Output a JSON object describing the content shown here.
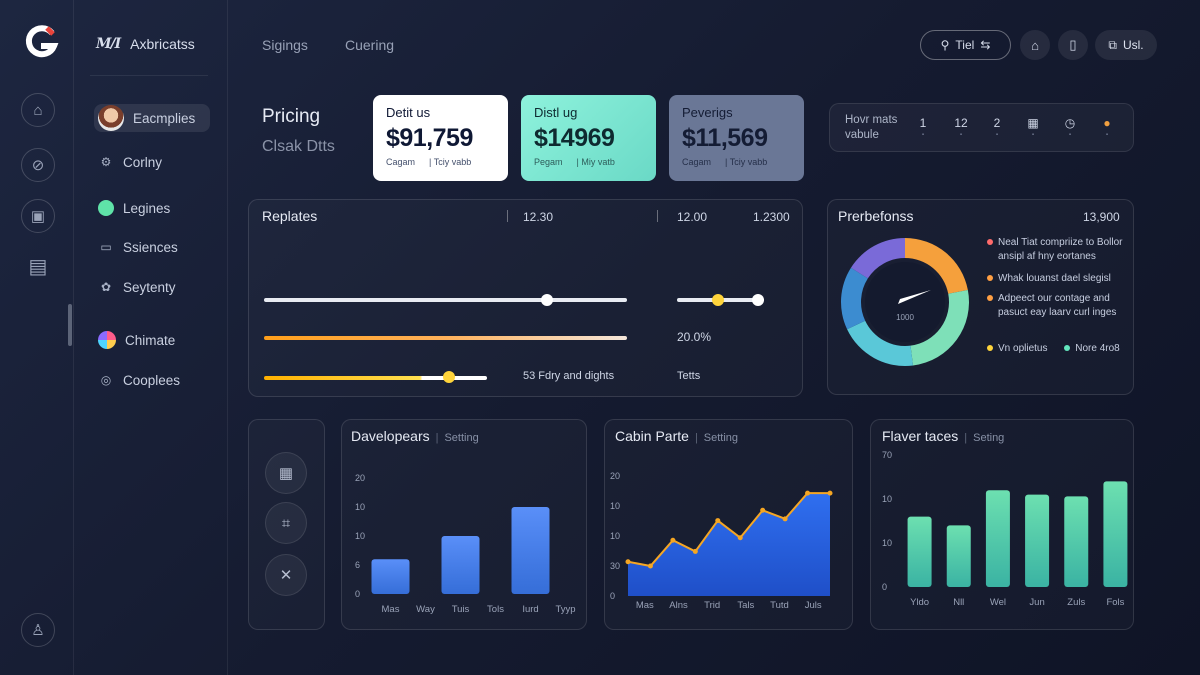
{
  "brand": {
    "mark": "M/I",
    "name": "Axbricatss"
  },
  "topnav": [
    {
      "label": "Sigings"
    },
    {
      "label": "Cuering"
    }
  ],
  "search": {
    "label": "Tiel"
  },
  "user": {
    "label": "Usl."
  },
  "sidebar": {
    "items": [
      {
        "label": "Eacmplies",
        "icon": "avatar"
      },
      {
        "label": "Corlny",
        "icon": "settings-icon"
      },
      {
        "label": "Legines",
        "icon": "green-dot-icon"
      },
      {
        "label": "Ssiences",
        "icon": "monitor-icon"
      },
      {
        "label": "Seytenty",
        "icon": "gear-icon"
      },
      {
        "label": "Chimate",
        "icon": "color-wheel-icon"
      },
      {
        "label": "Cooplees",
        "icon": "target-icon"
      }
    ]
  },
  "page": {
    "title": "Pricing",
    "subtitle": "Clsak Dtts"
  },
  "stats": [
    {
      "label": "Detit us",
      "value": "$91,759",
      "foot_left": "Cagam",
      "foot_right": "| Tciy vabb"
    },
    {
      "label": "Distl ug",
      "value": "$14969",
      "foot_left": "Pegam",
      "foot_right": "| Miy vatb"
    },
    {
      "label": "Peverigs",
      "value": "$11,569",
      "foot_left": "Cagam",
      "foot_right": "| Tciy vabb"
    }
  ],
  "iconbar": {
    "label_line1": "Hovr mats",
    "label_line2": "vabule",
    "cells": [
      "1",
      "12",
      "2",
      "",
      "",
      ""
    ]
  },
  "replates": {
    "title": "Replates",
    "col1": "12.30",
    "col2": "12.00",
    "col3": "1.2300",
    "row2_value": "20.0%",
    "row3_label": "53 Fdry and dights",
    "row3_value": "Tetts",
    "slider1_value": 0.78,
    "slider2_value": 0.47,
    "slider3_value": 0.83
  },
  "preferences": {
    "title": "Prerbefonss",
    "value": "13,900",
    "gauge_label": "1000",
    "legend": [
      {
        "text": "Neal Tiat compriize to Bollor",
        "color": "#ff6b6b"
      },
      {
        "text": "ansipl af hny eortanes",
        "color": ""
      },
      {
        "text": "Whak louanst dael slegisl",
        "color": "#ff9f43"
      },
      {
        "text": "Adpeect our contage and",
        "color": "#ff9f43"
      },
      {
        "text": "pasuct eay laarv curl inges",
        "color": ""
      }
    ],
    "legend_bottom": [
      {
        "text": "Vn oplietus",
        "color": "#ffd43b"
      },
      {
        "text": "Nore 4ro8",
        "color": "#63e6be"
      }
    ],
    "segments": [
      {
        "value": 22,
        "color": "#f5a03c"
      },
      {
        "value": 26,
        "color": "#7ee0b8"
      },
      {
        "value": 20,
        "color": "#5ac8d8"
      },
      {
        "value": 16,
        "color": "#3c8cd0"
      },
      {
        "value": 16,
        "color": "#7a6ad8"
      }
    ]
  },
  "chart_data": [
    {
      "type": "bar",
      "title": "Davelopears",
      "tag": "Setting",
      "categories": [
        "Mas",
        "Way",
        "Tuis",
        "Tols",
        "Iurd",
        "Tyyp"
      ],
      "values": [
        6,
        0,
        10,
        0,
        15,
        0
      ],
      "ylim": [
        0,
        20
      ],
      "yticks": [
        "20",
        "10",
        "10",
        "6",
        "0"
      ],
      "color": "#3b7cf5"
    },
    {
      "type": "area",
      "title": "Cabin Parte",
      "tag": "Setting",
      "categories": [
        "Mas",
        "Alns",
        "Trid",
        "Tals",
        "Tutd",
        "Juls"
      ],
      "values": [
        4,
        3.5,
        6.5,
        5.2,
        8.8,
        6.8,
        10,
        9,
        12,
        12
      ],
      "ylim": [
        0,
        14
      ],
      "yticks": [
        "20",
        "10",
        "10",
        "30",
        "0"
      ],
      "color": "#2f6ff0",
      "line_color": "#f5a623"
    },
    {
      "type": "bar",
      "title": "Flaver taces",
      "tag": "Seting",
      "categories": [
        "Yldo",
        "Nll",
        "Wel",
        "Jun",
        "Zuls",
        "Fols"
      ],
      "values": [
        8,
        7,
        11,
        10.5,
        10.3,
        12
      ],
      "ylim": [
        0,
        15
      ],
      "yticks": [
        "70",
        "10",
        "10",
        "0"
      ],
      "color": "#3fc4b0"
    }
  ]
}
